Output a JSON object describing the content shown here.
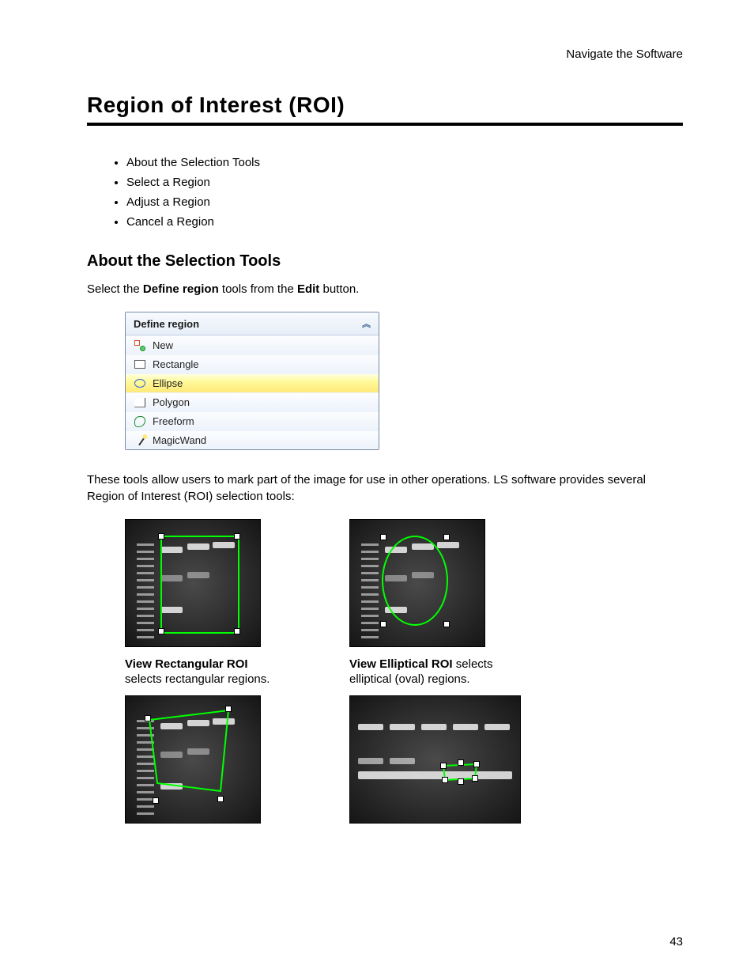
{
  "running_head": "Navigate the Software",
  "section_title": "Region of Interest (ROI)",
  "toc": [
    "About the Selection Tools",
    "Select a Region",
    "Adjust a Region",
    "Cancel a Region"
  ],
  "subheading": "About the Selection Tools",
  "intro_prefix": "Select the ",
  "intro_bold1": "Define region",
  "intro_mid": " tools from the ",
  "intro_bold2": "Edit",
  "intro_suffix": " button.",
  "panel": {
    "title": "Define region",
    "items": [
      {
        "label": "New",
        "icon": "new-icon"
      },
      {
        "label": "Rectangle",
        "icon": "rectangle-icon"
      },
      {
        "label": "Ellipse",
        "icon": "ellipse-icon"
      },
      {
        "label": "Polygon",
        "icon": "polygon-icon"
      },
      {
        "label": "Freeform",
        "icon": "freeform-icon"
      },
      {
        "label": "MagicWand",
        "icon": "magicwand-icon"
      }
    ]
  },
  "para2": "These tools allow users to mark part of the image for use in other operations. LS software provides several Region of Interest (ROI) selection tools:",
  "captions": {
    "rect_bold": "View Rectangular ROI",
    "rect_rest": " selects rectangular regions.",
    "ell_bold": "View Elliptical ROI",
    "ell_rest": " selects elliptical (oval) regions."
  },
  "page_number": "43"
}
